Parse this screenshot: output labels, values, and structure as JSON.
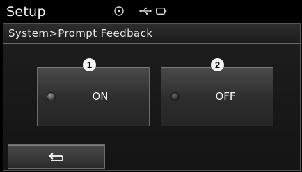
{
  "header": {
    "title": "Setup",
    "status_icons": [
      "disc-icon",
      "usb-icon",
      "battery-icon"
    ]
  },
  "breadcrumb": "System>Prompt Feedback",
  "options": [
    {
      "callout": "1",
      "label": "ON",
      "selected": true
    },
    {
      "callout": "2",
      "label": "OFF",
      "selected": false
    }
  ],
  "back_button": {
    "icon": "return-arrow-icon"
  },
  "colors": {
    "background": "#000000",
    "panel": "#1a1a1a",
    "button": "#3a3a3a",
    "text": "#ffffff"
  }
}
